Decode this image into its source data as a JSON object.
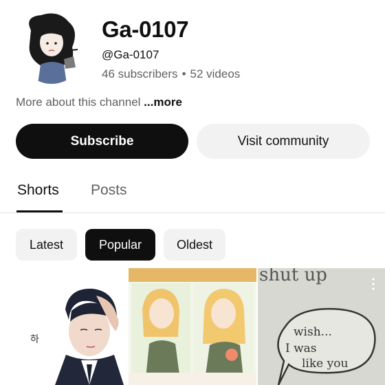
{
  "channel": {
    "name": "Ga-0107",
    "handle": "@Ga-0107",
    "subscribers": "46 subscribers",
    "separator": "•",
    "videos": "52 videos",
    "about_text": "More about this channel ",
    "about_more": "...more"
  },
  "actions": {
    "subscribe_label": "Subscribe",
    "community_label": "Visit community"
  },
  "tabs": {
    "items": [
      {
        "label": "Shorts",
        "selected": true
      },
      {
        "label": "Posts",
        "selected": false
      }
    ]
  },
  "filters": {
    "items": [
      {
        "label": "Latest",
        "selected": false
      },
      {
        "label": "Popular",
        "selected": true
      },
      {
        "label": "Oldest",
        "selected": false
      }
    ]
  },
  "shorts": {
    "items": [
      {
        "caption": "하"
      },
      {
        "caption": "shut up"
      },
      {
        "caption": "wish... I was like you"
      }
    ]
  },
  "colors": {
    "primary_text": "#0f0f0f",
    "secondary_text": "#606060",
    "chip_bg": "#f2f2f2",
    "selected_bg": "#0f0f0f"
  }
}
